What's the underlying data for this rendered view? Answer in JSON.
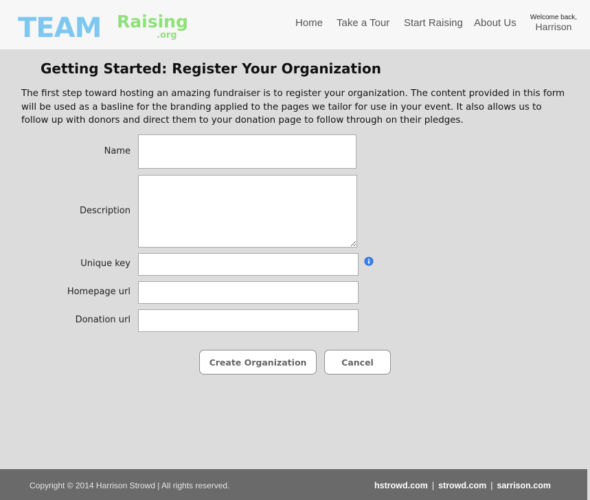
{
  "header": {
    "logo": {
      "team_text": "TEAM",
      "raising_text": "Raising",
      "org_text": ".org",
      "team_color": "#7ec8f0",
      "raising_color": "#8fe07a"
    },
    "nav": [
      {
        "label": "Home"
      },
      {
        "label": "Take a Tour"
      },
      {
        "label": "Start Raising"
      },
      {
        "label": "About Us"
      }
    ],
    "welcome": {
      "greeting": "Welcome back,",
      "user": "Harrison"
    }
  },
  "main": {
    "title": "Getting Started: Register Your Organization",
    "intro": "The first step toward hosting an amazing fundraiser is to register your organization. The content provided in this form will be used as a basline for the branding applied to the pages we tailor for use in your event. It also allows us to follow up with donors and direct them to your donation page to follow through on their pledges.",
    "form": {
      "name_label": "Name",
      "name_value": "",
      "description_label": "Description",
      "description_value": "",
      "unique_key_label": "Unique key",
      "unique_key_value": "",
      "homepage_label": "Homepage url",
      "homepage_value": "",
      "donation_label": "Donation url",
      "donation_value": "",
      "info_icon": "info-icon",
      "info_color": "#2a6fdb"
    },
    "buttons": {
      "create_label": "Create Organization",
      "cancel_label": "Cancel"
    }
  },
  "footer": {
    "copyright": "Copyright © 2014 Harrison Strowd  |  All rights reserved.",
    "links": [
      {
        "label": "hstrowd.com"
      },
      {
        "label": "strowd.com"
      },
      {
        "label": "sarrison.com"
      }
    ]
  }
}
